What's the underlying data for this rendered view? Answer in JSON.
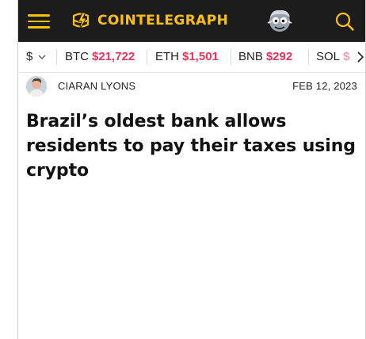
{
  "header": {
    "brand": "COINTELEGRAPH",
    "accent_color": "#ffc107",
    "background_color": "#1c1c1c",
    "icons": [
      "menu-icon",
      "cointelegraph-logo-icon",
      "mascot-icon",
      "search-icon"
    ]
  },
  "ticker": {
    "currency": "$",
    "items": [
      {
        "symbol": "BTC",
        "price": "$21,722"
      },
      {
        "symbol": "ETH",
        "price": "$1,501"
      },
      {
        "symbol": "BNB",
        "price": "$292"
      },
      {
        "symbol": "SOL",
        "price": "$"
      }
    ],
    "price_color": "#e8355b"
  },
  "article": {
    "author": "CIARAN LYONS",
    "date": "FEB 12, 2023",
    "title": "Brazil’s oldest bank allows residents to pay their taxes using crypto"
  }
}
